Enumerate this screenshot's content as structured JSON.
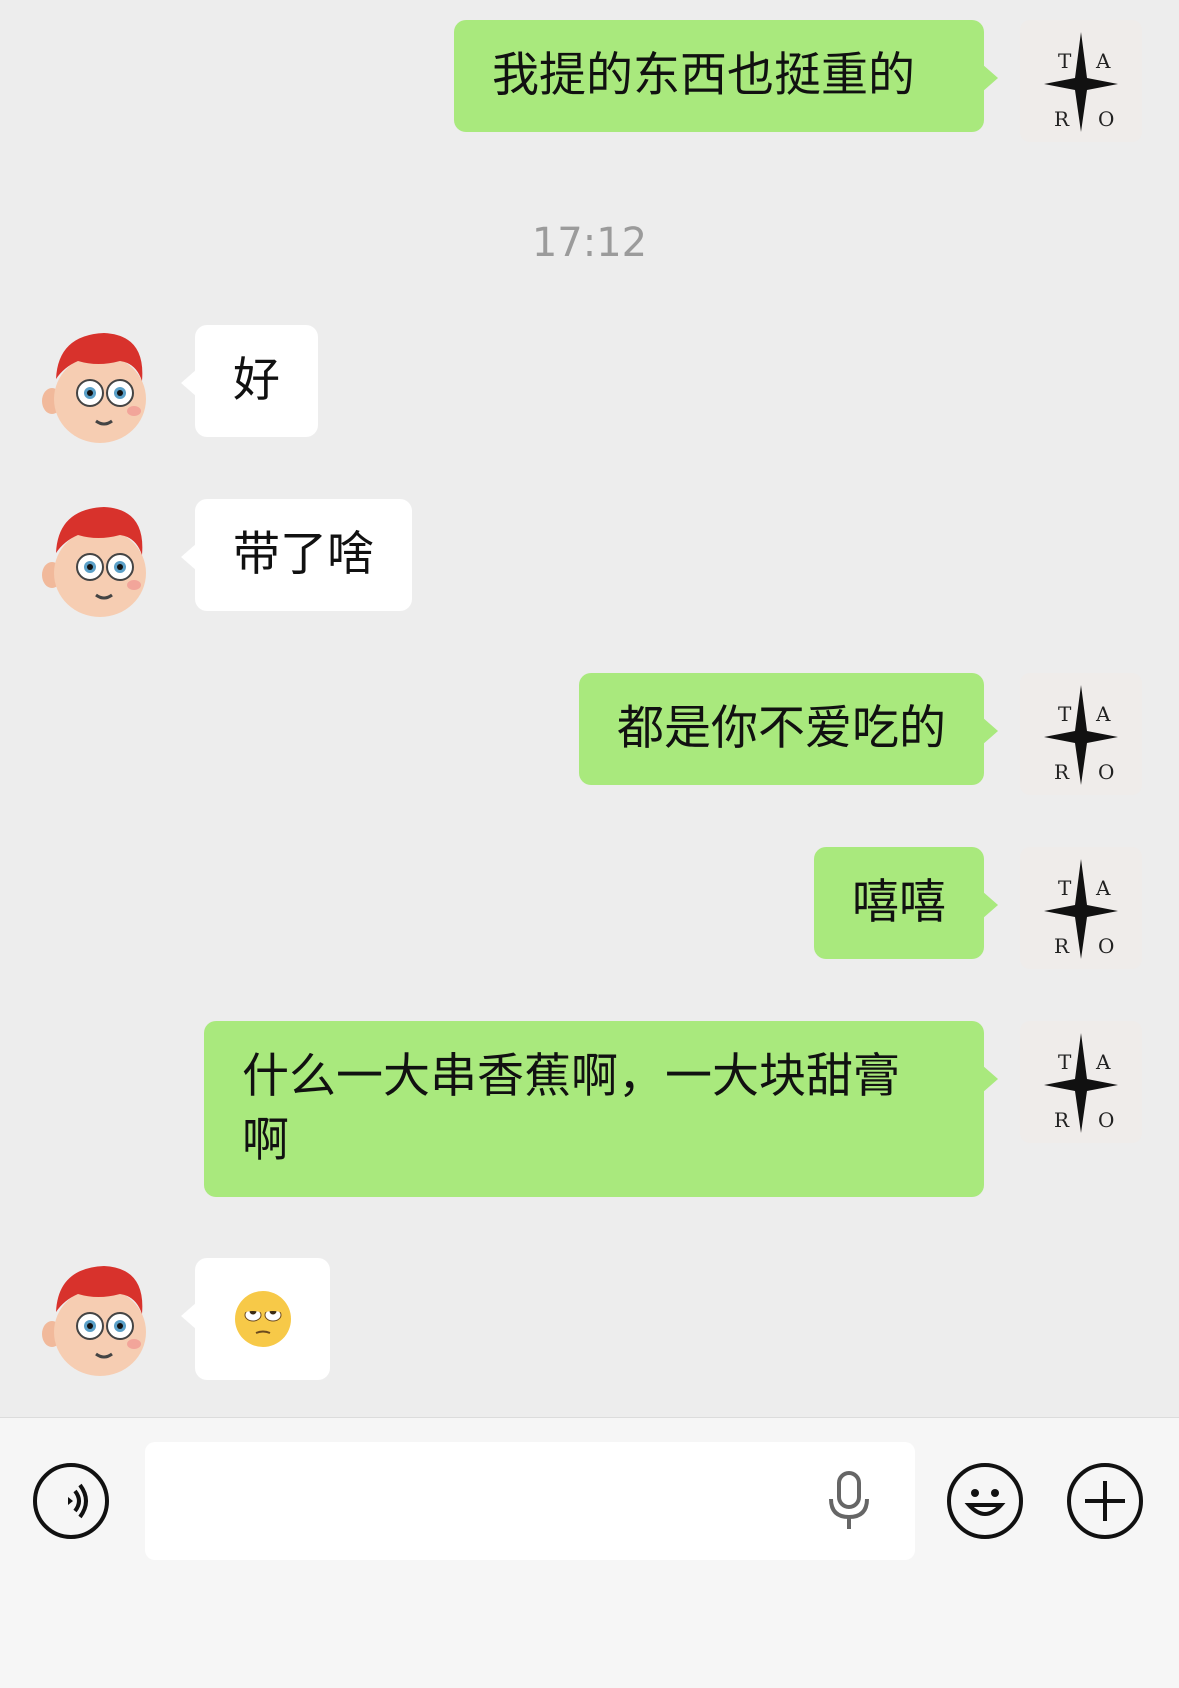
{
  "messages": [
    {
      "side": "me",
      "text": "我提的东西也挺重的"
    },
    {
      "type": "time",
      "text": "17:12"
    },
    {
      "side": "other",
      "text": "好"
    },
    {
      "side": "other",
      "text": "带了啥"
    },
    {
      "side": "me",
      "text": "都是你不爱吃的"
    },
    {
      "side": "me",
      "text": "嘻嘻"
    },
    {
      "side": "me",
      "text": "什么一大串香蕉啊，一大块甜膏啊"
    },
    {
      "side": "other",
      "text": "",
      "emoji": "rolling-eyes-emoji"
    }
  ],
  "my_avatar": {
    "letters": [
      "T",
      "A",
      "R",
      "O"
    ]
  },
  "input_bar": {
    "value": "",
    "icons": [
      "voice-icon",
      "microphone-icon",
      "emoji-icon",
      "plus-icon"
    ]
  },
  "colors": {
    "my_bubble": "#a9e97d",
    "other_bubble": "#ffffff",
    "background": "#ededed"
  }
}
